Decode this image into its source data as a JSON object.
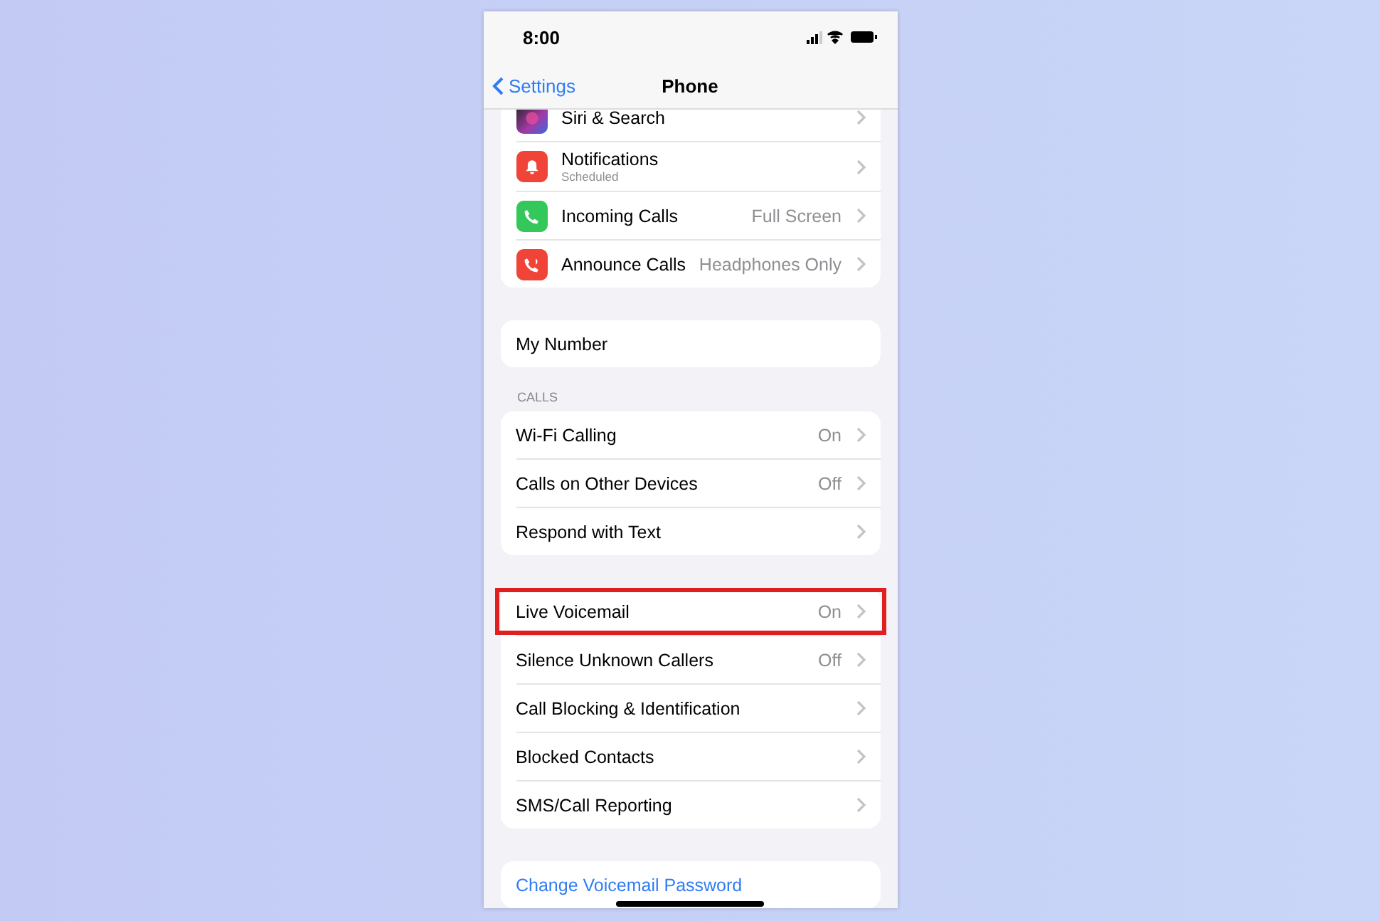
{
  "status_bar": {
    "time": "8:00"
  },
  "nav": {
    "back": "Settings",
    "title": "Phone"
  },
  "sections": [
    {
      "rows": [
        {
          "kind": "siri",
          "label": "Siri & Search"
        },
        {
          "kind": "notifications",
          "label": "Notifications",
          "subtitle": "Scheduled"
        },
        {
          "kind": "incoming",
          "label": "Incoming Calls",
          "value": "Full Screen"
        },
        {
          "kind": "announce",
          "label": "Announce Calls",
          "value": "Headphones Only"
        }
      ]
    },
    {
      "rows": [
        {
          "label": "My Number",
          "chevron": false
        }
      ]
    },
    {
      "header": "CALLS",
      "rows": [
        {
          "label": "Wi-Fi Calling",
          "value": "On"
        },
        {
          "label": "Calls on Other Devices",
          "value": "Off"
        },
        {
          "label": "Respond with Text"
        }
      ]
    },
    {
      "rows": [
        {
          "label": "Live Voicemail",
          "value": "On",
          "highlighted": true
        },
        {
          "label": "Silence Unknown Callers",
          "value": "Off"
        },
        {
          "label": "Call Blocking & Identification"
        },
        {
          "label": "Blocked Contacts"
        },
        {
          "label": "SMS/Call Reporting"
        }
      ]
    },
    {
      "rows": [
        {
          "label": "Change Voicemail Password",
          "kind": "link",
          "chevron": false
        }
      ]
    }
  ]
}
